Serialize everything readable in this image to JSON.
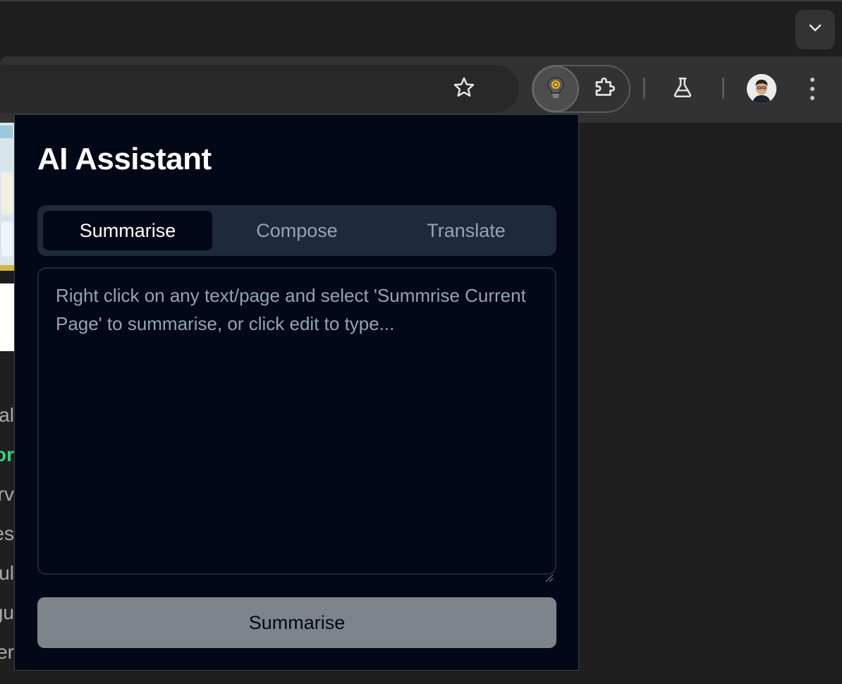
{
  "browser": {
    "toolbar": {
      "bookmark_icon": "star-icon",
      "extension_active_icon": "lightbulb-icon",
      "extensions_icon": "puzzle-icon",
      "labs_icon": "flask-icon",
      "menu_icon": "kebab-menu-icon",
      "tab_search_icon": "chevron-down-icon"
    }
  },
  "background_page": {
    "text_fragments": [
      "al",
      "or",
      "rv",
      "es",
      "ul",
      "gu",
      "er"
    ]
  },
  "popup": {
    "title": "AI Assistant",
    "tabs": [
      {
        "label": "Summarise",
        "active": true
      },
      {
        "label": "Compose",
        "active": false
      },
      {
        "label": "Translate",
        "active": false
      }
    ],
    "input": {
      "value": "",
      "placeholder": "Right click on any text/page and select 'Summrise Current Page' to summarise, or click edit to type..."
    },
    "primary_button": "Summarise"
  },
  "colors": {
    "popup_bg": "#020817",
    "tab_bar_bg": "#1e293b",
    "muted_text": "#94a3b8",
    "button_bg": "#7f838c",
    "bulb_accent": "#e8b82a"
  }
}
